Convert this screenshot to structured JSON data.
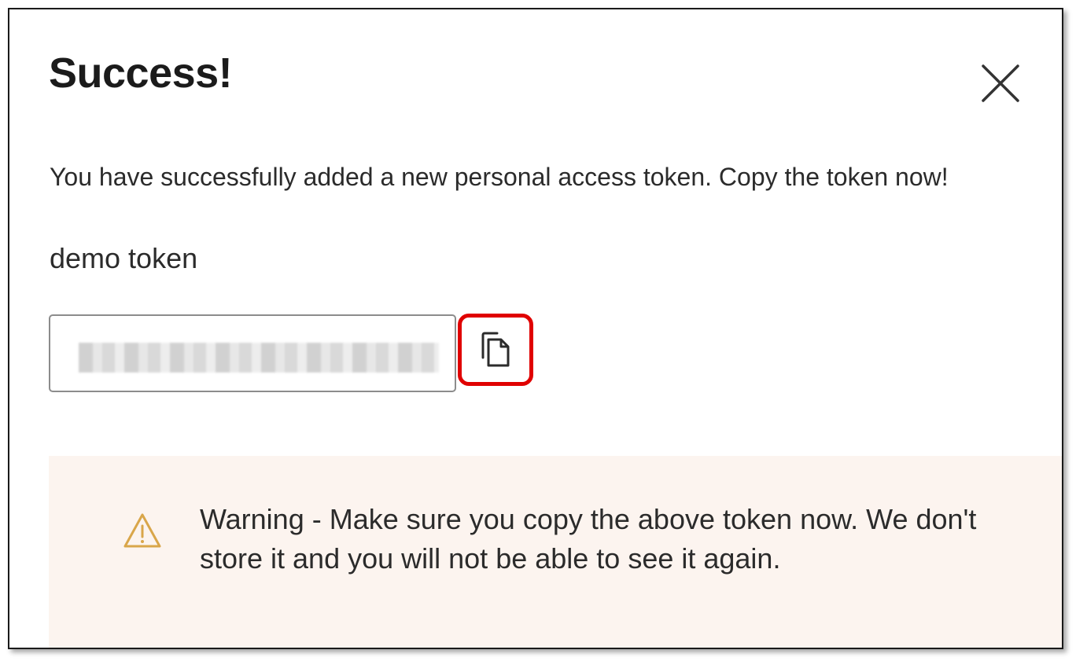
{
  "dialog": {
    "title": "Success!",
    "message": "You have successfully added a new personal access token. Copy the token now!",
    "token_name": "demo token",
    "token_value": "",
    "warning": "Warning - Make sure you copy the above token now. We don't store it and you will not be able to see it again."
  },
  "icons": {
    "close": "close-icon",
    "copy": "copy-icon",
    "warning": "warning-triangle-icon"
  },
  "colors": {
    "highlight": "#e00000",
    "warning_background": "#fcf4ef",
    "warning_icon": "#d9a64a"
  }
}
